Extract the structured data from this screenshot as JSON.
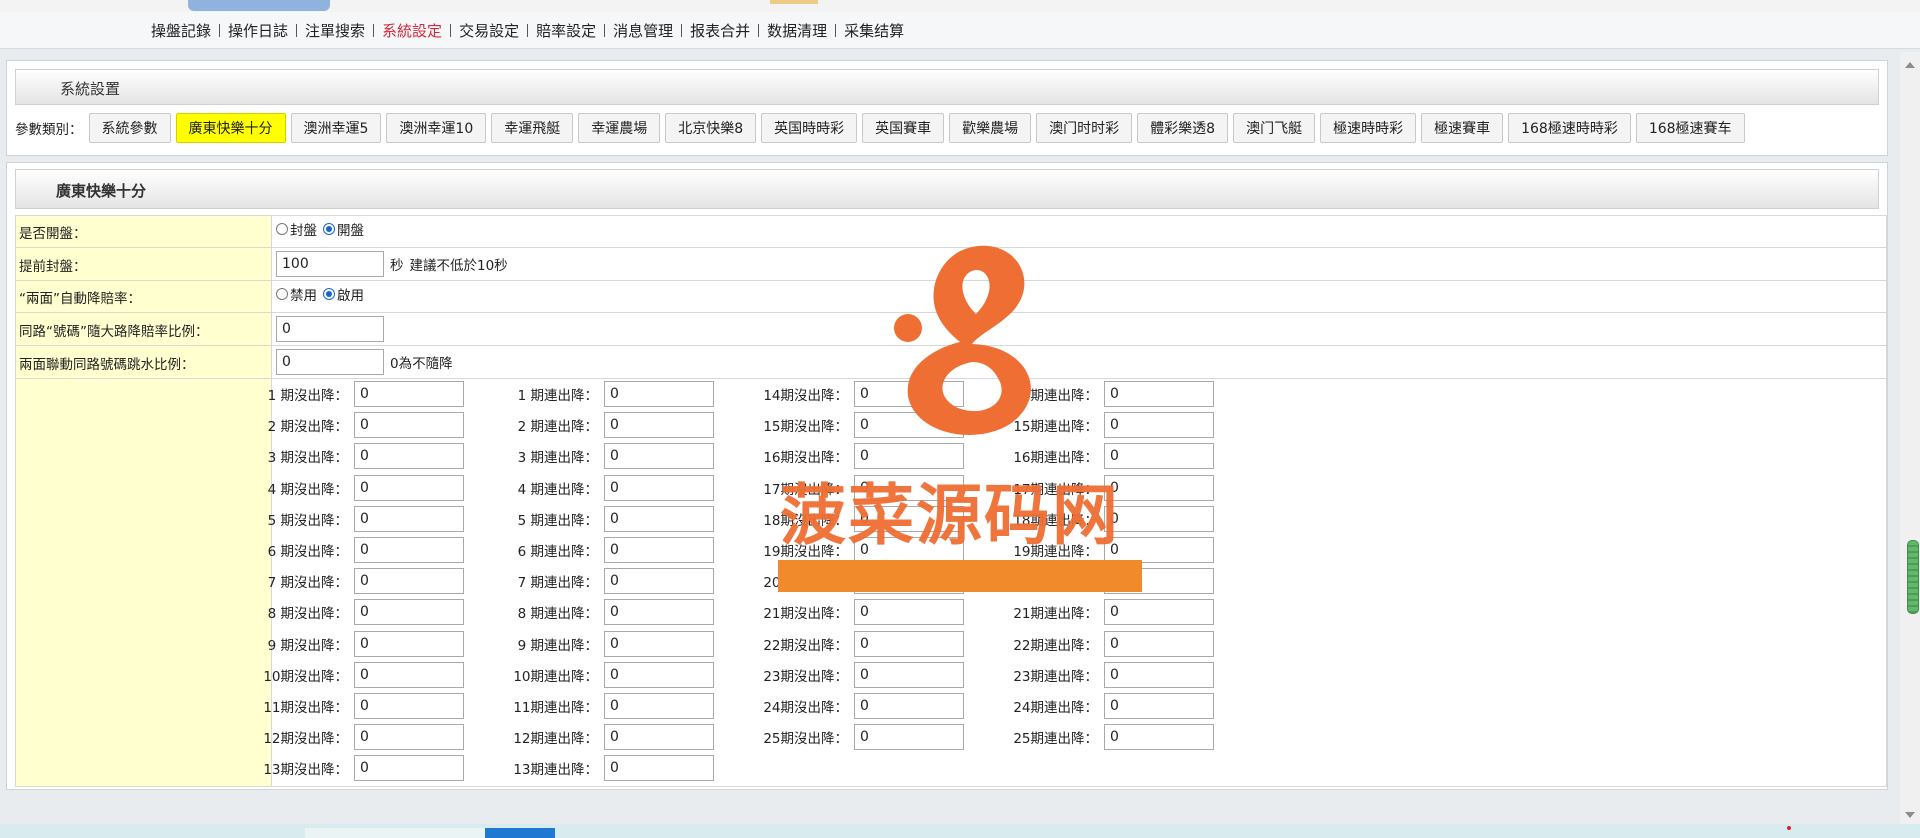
{
  "nav": {
    "items": [
      {
        "label": "操盤記錄",
        "active": false
      },
      {
        "label": "操作日誌",
        "active": false
      },
      {
        "label": "注單搜索",
        "active": false
      },
      {
        "label": "系統設定",
        "active": true
      },
      {
        "label": "交易設定",
        "active": false
      },
      {
        "label": "賠率設定",
        "active": false
      },
      {
        "label": "消息管理",
        "active": false
      },
      {
        "label": "报表合并",
        "active": false
      },
      {
        "label": "数据清理",
        "active": false
      },
      {
        "label": "采集结算",
        "active": false
      }
    ]
  },
  "system_panel": {
    "title": "系統設置",
    "param_label": "參數類別：",
    "params": [
      {
        "label": "系統參數",
        "active": false
      },
      {
        "label": "廣東快樂十分",
        "active": true
      },
      {
        "label": "澳洲幸運5",
        "active": false
      },
      {
        "label": "澳洲幸運10",
        "active": false
      },
      {
        "label": "幸運飛艇",
        "active": false
      },
      {
        "label": "幸運農場",
        "active": false
      },
      {
        "label": "北京快樂8",
        "active": false
      },
      {
        "label": "英国時時彩",
        "active": false
      },
      {
        "label": "英国賽車",
        "active": false
      },
      {
        "label": "歡樂農場",
        "active": false
      },
      {
        "label": "澳门时时彩",
        "active": false
      },
      {
        "label": "體彩樂透8",
        "active": false
      },
      {
        "label": "澳门飞艇",
        "active": false
      },
      {
        "label": "極速時時彩",
        "active": false
      },
      {
        "label": "極速賽車",
        "active": false
      },
      {
        "label": "168極速時時彩",
        "active": false
      },
      {
        "label": "168極速賽车",
        "active": false
      }
    ]
  },
  "game_panel": {
    "title": "廣東快樂十分",
    "open": {
      "label": "是否開盤：",
      "options": [
        "封盤",
        "開盤"
      ],
      "selected": "開盤"
    },
    "close_ahead": {
      "label": "提前封盤：",
      "value": "100",
      "unit": "秒",
      "note": "建議不低於10秒"
    },
    "auto_reduce": {
      "label": "“兩面”自動降賠率：",
      "options": [
        "禁用",
        "啟用"
      ],
      "selected": "啟用"
    },
    "same_road": {
      "label": "同路“號碼”隨大路降賠率比例：",
      "value": "0"
    },
    "linked_ratio": {
      "label": "兩面聯動同路號碼跳水比例：",
      "value": "0",
      "note": "0為不隨降"
    },
    "rates": [
      {
        "label": "1 期沒出降：",
        "value": "0"
      },
      {
        "label": "1 期連出降：",
        "value": "0"
      },
      {
        "label": "14期沒出降：",
        "value": "0"
      },
      {
        "label": "14期連出降：",
        "value": "0"
      },
      {
        "label": "2 期沒出降：",
        "value": "0"
      },
      {
        "label": "2 期連出降：",
        "value": "0"
      },
      {
        "label": "15期沒出降：",
        "value": "0"
      },
      {
        "label": "15期連出降：",
        "value": "0"
      },
      {
        "label": "3 期沒出降：",
        "value": "0"
      },
      {
        "label": "3 期連出降：",
        "value": "0"
      },
      {
        "label": "16期沒出降：",
        "value": "0"
      },
      {
        "label": "16期連出降：",
        "value": "0"
      },
      {
        "label": "4 期沒出降：",
        "value": "0"
      },
      {
        "label": "4 期連出降：",
        "value": "0"
      },
      {
        "label": "17期沒出降：",
        "value": "0"
      },
      {
        "label": "17期連出降：",
        "value": "0"
      },
      {
        "label": "5 期沒出降：",
        "value": "0"
      },
      {
        "label": "5 期連出降：",
        "value": "0"
      },
      {
        "label": "18期沒出降：",
        "value": "0"
      },
      {
        "label": "18期連出降：",
        "value": "0"
      },
      {
        "label": "6 期沒出降：",
        "value": "0"
      },
      {
        "label": "6 期連出降：",
        "value": "0"
      },
      {
        "label": "19期沒出降：",
        "value": "0"
      },
      {
        "label": "19期連出降：",
        "value": "0"
      },
      {
        "label": "7 期沒出降：",
        "value": "0"
      },
      {
        "label": "7 期連出降：",
        "value": "0"
      },
      {
        "label": "20期沒出降：",
        "value": "0"
      },
      {
        "label": "20期連出降：",
        "value": "0"
      },
      {
        "label": "8 期沒出降：",
        "value": "0"
      },
      {
        "label": "8 期連出降：",
        "value": "0"
      },
      {
        "label": "21期沒出降：",
        "value": "0"
      },
      {
        "label": "21期連出降：",
        "value": "0"
      },
      {
        "label": "9 期沒出降：",
        "value": "0"
      },
      {
        "label": "9 期連出降：",
        "value": "0"
      },
      {
        "label": "22期沒出降：",
        "value": "0"
      },
      {
        "label": "22期連出降：",
        "value": "0"
      },
      {
        "label": "10期沒出降：",
        "value": "0"
      },
      {
        "label": "10期連出降：",
        "value": "0"
      },
      {
        "label": "23期沒出降：",
        "value": "0"
      },
      {
        "label": "23期連出降：",
        "value": "0"
      },
      {
        "label": "11期沒出降：",
        "value": "0"
      },
      {
        "label": "11期連出降：",
        "value": "0"
      },
      {
        "label": "24期沒出降：",
        "value": "0"
      },
      {
        "label": "24期連出降：",
        "value": "0"
      },
      {
        "label": "12期沒出降：",
        "value": "0"
      },
      {
        "label": "12期連出降：",
        "value": "0"
      },
      {
        "label": "25期沒出降：",
        "value": "0"
      },
      {
        "label": "25期連出降：",
        "value": "0"
      },
      {
        "label": "13期沒出降：",
        "value": "0"
      },
      {
        "label": "13期連出降：",
        "value": "0"
      }
    ]
  },
  "watermark": {
    "text": "菠菜源码网"
  },
  "colors": {
    "active_tab_bg": "#ffff00",
    "label_col_bg": "#ffffd0",
    "nav_active": "#d3283b",
    "watermark": "#ef6e33"
  }
}
